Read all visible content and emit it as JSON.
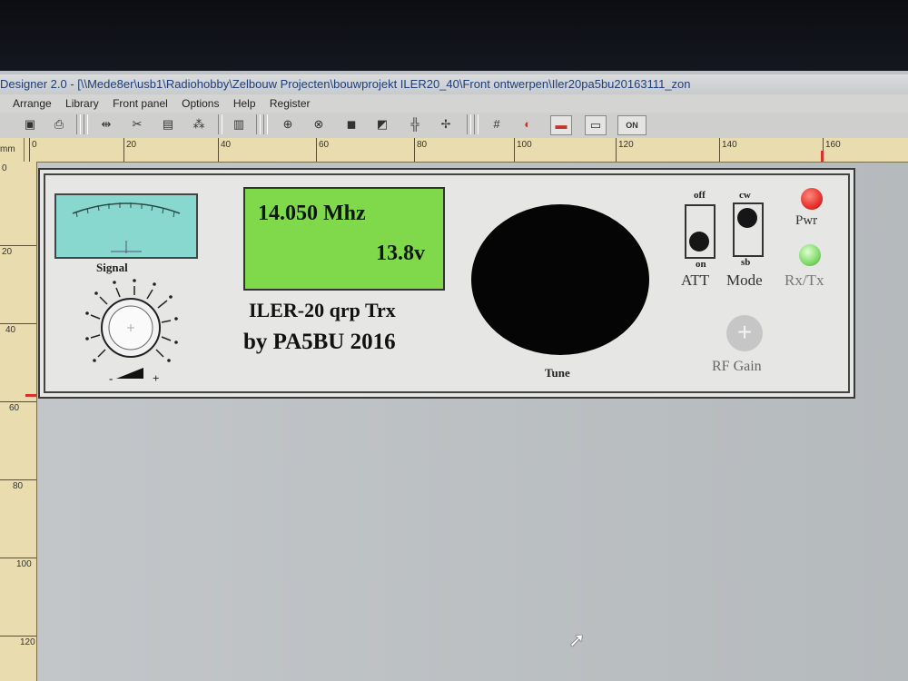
{
  "window": {
    "title": "Designer 2.0 - [\\\\Mede8er\\usb1\\Radiohobby\\Zelbouw Projecten\\bouwprojekt ILER20_40\\Front ontwerpen\\Iler20pa5bu20163111_zon"
  },
  "menu": {
    "items": [
      "Arrange",
      "Library",
      "Front panel",
      "Options",
      "Help",
      "Register"
    ]
  },
  "toolbar": {
    "icons": [
      "save-icon",
      "print-icon",
      "mirror-icon",
      "cut-icon",
      "paste-icon",
      "group-icon",
      "delete-icon",
      "lock-icon",
      "unlock-icon",
      "bring-front-icon",
      "send-back-icon",
      "align-icon",
      "distribute-icon",
      "grid-icon",
      "color-icon",
      "screen-icon",
      "component-icon",
      "switch-on-icon"
    ],
    "switch_icon_text": "ON"
  },
  "rulers": {
    "unit": "mm",
    "top_labels": [
      "0",
      "20",
      "40",
      "60",
      "80",
      "100",
      "120",
      "140",
      "160"
    ],
    "left_labels": [
      "0",
      "20",
      "40",
      "60",
      "80",
      "100",
      "120"
    ]
  },
  "panel": {
    "meter_label": "Signal",
    "frequency": "14.050 Mhz",
    "voltage": "13.8v",
    "title_line1": "ILER-20 qrp Trx",
    "title_line2": "by PA5BU  2016",
    "tune_label": "Tune",
    "att_top": "off",
    "att_bottom": "on",
    "att_label": "ATT",
    "mode_top": "cw",
    "mode_bottom": "sb",
    "mode_label": "Mode",
    "pwr_label": "Pwr",
    "rxtx_label": "Rx/Tx",
    "rf_gain_label": "RF Gain",
    "volume_minus": "-",
    "volume_plus": "+"
  },
  "colors": {
    "lcd": "#7fd94a",
    "meter": "#88d8d0",
    "led_pwr": "#e8302c",
    "led_rxtx": "#7fd96a"
  }
}
